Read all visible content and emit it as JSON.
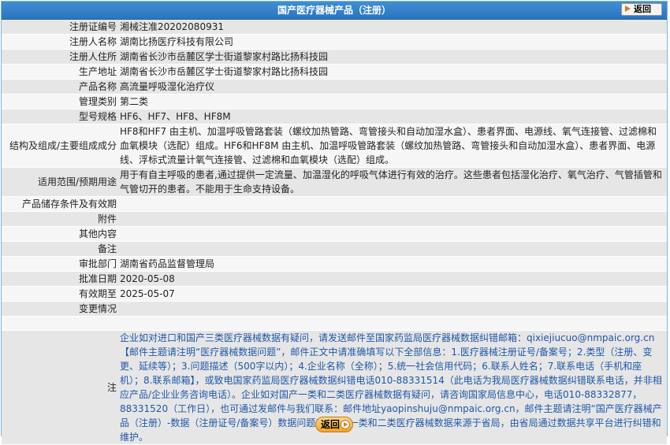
{
  "header": {
    "title": "国产医疗器械产品（注册）",
    "back_label": "返回"
  },
  "rows": [
    {
      "label": "注册证编号",
      "value": "湘械注准20202080931"
    },
    {
      "label": "注册人名称",
      "value": "湖南比扬医疗科技有限公司"
    },
    {
      "label": "注册人住所",
      "value": "湖南省长沙市岳麓区学士街道黎家村路比扬科技园"
    },
    {
      "label": "生产地址",
      "value": "湖南省长沙市岳麓区学士街道黎家村路比扬科技园"
    },
    {
      "label": "产品名称",
      "value": "高流量呼吸湿化治疗仪"
    },
    {
      "label": "管理类别",
      "value": "第二类"
    },
    {
      "label": "型号规格",
      "value": "HF6、HF7、HF8、HF8M"
    },
    {
      "label": "结构及组成/主要组成成分",
      "value": "HF8和HF7 由主机、加温呼吸管路套装（螺纹加热管路、弯管接头和自动加湿水盒）、患者界面、电源线、氧气连接管、过滤棉和血氧模块（选配）组成。HF6和HF8M 由主机、加温呼吸管路套装（螺纹加热管路、弯管接头和自动加湿水盒）、患者界面、电源线、浮标式流量计氧气连接管、过滤棉和血氧模块（选配）组成。"
    },
    {
      "label": "适用范围/预期用途",
      "value": "用于有自主呼吸的患者,通过提供一定流量、加温湿化的呼吸气体进行有效的治疗。这些患者包括湿化治疗、氧气治疗、气管插管和气管切开的患者。不能用于生命支持设备。"
    },
    {
      "label": "产品储存条件及有效期",
      "value": ""
    },
    {
      "label": "附件",
      "value": ""
    },
    {
      "label": "其他内容",
      "value": ""
    },
    {
      "label": "备注",
      "value": ""
    },
    {
      "label": "审批部门",
      "value": "湖南省药品监督管理局"
    },
    {
      "label": "批准日期",
      "value": "2020-05-08"
    },
    {
      "label": "有效期至",
      "value": "2025-05-07"
    },
    {
      "label": "变更情况",
      "value": ""
    }
  ],
  "notes": {
    "label": "注",
    "text": "企业如对进口和国产三类医疗器械数据有疑问，请发送邮件至国家药监局医疗器械数据纠错邮箱：qixiejiucuo@nmpaic.org.cn【邮件主题请注明“医疗器械数据问题”，邮件正文中请准确填写以下全部信息：1.医疗器械注册证号/备案号；2.类型（注册、变更、延续等）；3.问题描述（500字以内）；4.企业名称（全称）；5.统一社会信用代码；6.联系人姓名；7.联系电话（手机和座机）；8.联系邮箱】，或致电国家药监局医疗器械数据纠错电话010-88331514（此电话为我局医疗器械数据纠错联系电话，并非相应产品/企业业务咨询电话）。企业如对国产一类和二类医疗器械数据有疑问，请咨询国家局信息中心，电话010-88332877，88331520（工作日），也可通过发邮件与我们联系：邮件地址yaopinshuju@nmpaic.org.cn，邮件主题请注明“国产医疗器械产品（注册）-数据（注册证号/备案号）数据问题”。国产一类和二类医疗器械数据来源于省局，由省局通过数据共享平台进行纠错和维护。"
  },
  "footer": {
    "back_label": "返回"
  }
}
